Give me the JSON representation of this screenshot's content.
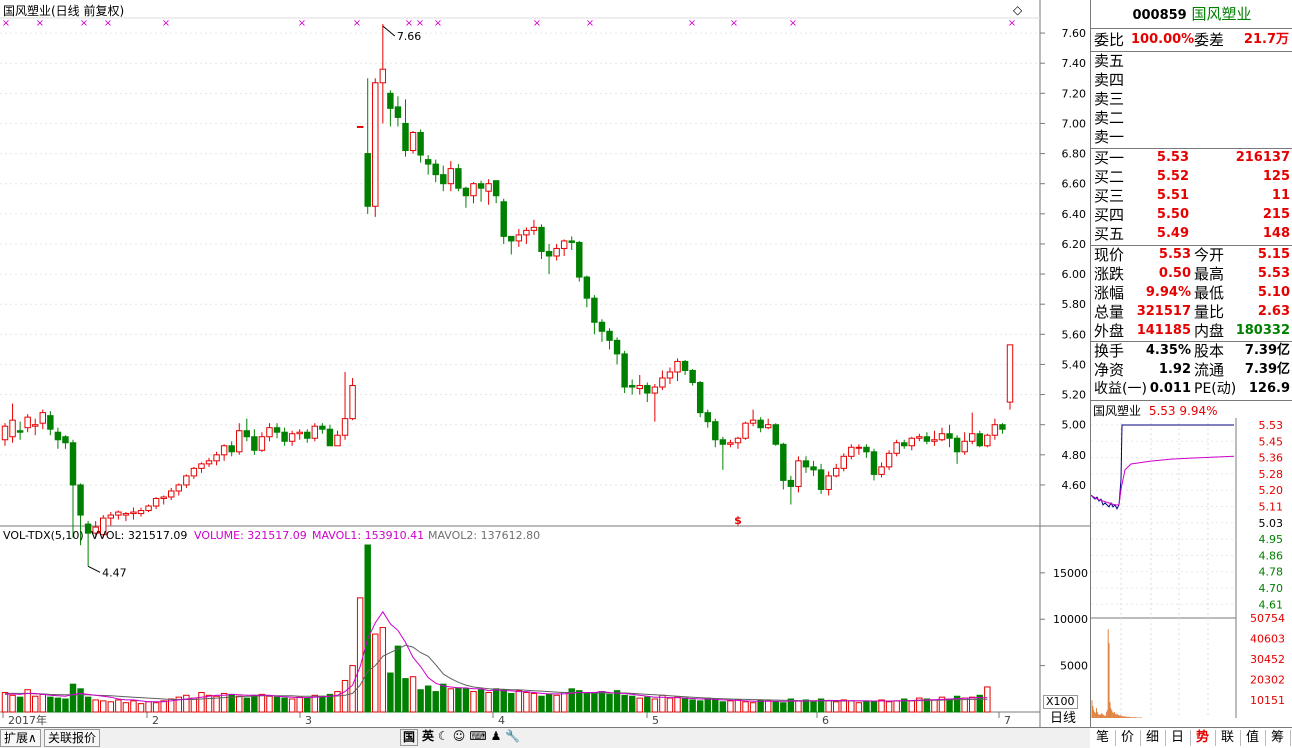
{
  "kline": {
    "header": "国风塑业(日线 前复权)",
    "high_marker": "7.66",
    "low_marker": "4.47",
    "special_marker": "$",
    "ymin": 4.5,
    "ymax": 7.7,
    "y_ticks": [
      "7.60",
      "7.40",
      "7.20",
      "7.00",
      "6.80",
      "6.60",
      "6.40",
      "6.20",
      "6.00",
      "5.80",
      "5.60",
      "5.40",
      "5.20",
      "5.00",
      "4.80",
      "4.60"
    ],
    "candles": [
      [
        4.9,
        4.99,
        4.86,
        5.01
      ],
      [
        4.92,
        5.03,
        4.88,
        5.14
      ],
      [
        4.96,
        4.95,
        4.9,
        5.02
      ],
      [
        4.98,
        5.05,
        4.95,
        5.07
      ],
      [
        4.99,
        5.0,
        4.93,
        5.04
      ],
      [
        5.01,
        5.08,
        4.97,
        5.1
      ],
      [
        5.06,
        4.97,
        4.93,
        5.09
      ],
      [
        4.95,
        4.9,
        4.84,
        4.98
      ],
      [
        4.92,
        4.88,
        4.84,
        4.93
      ],
      [
        4.88,
        4.6,
        4.25,
        4.9
      ],
      [
        4.6,
        4.4,
        4.2,
        4.61
      ],
      [
        4.34,
        4.28,
        4.06,
        4.36
      ],
      [
        4.28,
        4.32,
        4.25,
        4.36
      ],
      [
        4.27,
        4.38,
        4.25,
        4.4
      ],
      [
        4.38,
        4.4,
        4.33,
        4.42
      ],
      [
        4.4,
        4.42,
        4.37,
        4.43
      ],
      [
        4.4,
        4.41,
        4.36,
        4.42
      ],
      [
        4.41,
        4.42,
        4.37,
        4.45
      ],
      [
        4.41,
        4.43,
        4.39,
        4.45
      ],
      [
        4.43,
        4.46,
        4.42,
        4.47
      ],
      [
        4.46,
        4.51,
        4.44,
        4.52
      ],
      [
        4.51,
        4.52,
        4.47,
        4.53
      ],
      [
        4.52,
        4.56,
        4.5,
        4.58
      ],
      [
        4.56,
        4.6,
        4.53,
        4.61
      ],
      [
        4.6,
        4.66,
        4.58,
        4.67
      ],
      [
        4.66,
        4.71,
        4.64,
        4.72
      ],
      [
        4.71,
        4.74,
        4.68,
        4.75
      ],
      [
        4.74,
        4.76,
        4.72,
        4.78
      ],
      [
        4.76,
        4.8,
        4.73,
        4.82
      ],
      [
        4.8,
        4.86,
        4.76,
        4.87
      ],
      [
        4.86,
        4.82,
        4.79,
        4.89
      ],
      [
        4.82,
        4.96,
        4.8,
        5.01
      ],
      [
        4.96,
        4.92,
        4.89,
        5.04
      ],
      [
        4.92,
        4.83,
        4.8,
        4.97
      ],
      [
        4.83,
        4.92,
        4.82,
        4.95
      ],
      [
        4.92,
        4.98,
        4.89,
        5.01
      ],
      [
        4.98,
        4.95,
        4.91,
        5.01
      ],
      [
        4.95,
        4.89,
        4.86,
        4.98
      ],
      [
        4.89,
        4.94,
        4.86,
        4.96
      ],
      [
        4.94,
        4.95,
        4.9,
        4.97
      ],
      [
        4.95,
        4.91,
        4.88,
        4.97
      ],
      [
        4.91,
        4.99,
        4.89,
        5.01
      ],
      [
        4.99,
        4.97,
        4.94,
        5.01
      ],
      [
        4.97,
        4.86,
        4.86,
        5.0
      ],
      [
        4.86,
        4.93,
        4.86,
        4.96
      ],
      [
        4.93,
        5.04,
        4.9,
        5.35
      ],
      [
        5.04,
        5.26,
        5.03,
        5.31
      ],
      [
        6.98,
        6.98,
        6.98,
        6.98
      ],
      [
        6.8,
        6.45,
        6.4,
        7.3
      ],
      [
        6.45,
        7.27,
        6.38,
        7.3
      ],
      [
        7.27,
        7.36,
        7.0,
        7.66
      ],
      [
        7.2,
        7.1,
        6.98,
        7.22
      ],
      [
        7.11,
        7.04,
        6.98,
        7.18
      ],
      [
        7.0,
        6.82,
        6.78,
        7.16
      ],
      [
        6.82,
        6.94,
        6.8,
        6.95
      ],
      [
        6.94,
        6.79,
        6.74,
        6.96
      ],
      [
        6.76,
        6.73,
        6.66,
        6.79
      ],
      [
        6.73,
        6.66,
        6.61,
        6.76
      ],
      [
        6.66,
        6.6,
        6.55,
        6.72
      ],
      [
        6.6,
        6.7,
        6.55,
        6.75
      ],
      [
        6.7,
        6.57,
        6.55,
        6.73
      ],
      [
        6.57,
        6.52,
        6.44,
        6.58
      ],
      [
        6.52,
        6.6,
        6.47,
        6.61
      ],
      [
        6.6,
        6.57,
        6.48,
        6.62
      ],
      [
        6.55,
        6.6,
        6.46,
        6.63
      ],
      [
        6.62,
        6.52,
        6.47,
        6.62
      ],
      [
        6.48,
        6.25,
        6.2,
        6.5
      ],
      [
        6.25,
        6.22,
        6.13,
        6.25
      ],
      [
        6.22,
        6.26,
        6.18,
        6.3
      ],
      [
        6.26,
        6.29,
        6.2,
        6.31
      ],
      [
        6.29,
        6.31,
        6.26,
        6.36
      ],
      [
        6.31,
        6.15,
        6.1,
        6.33
      ],
      [
        6.15,
        6.12,
        6.0,
        6.2
      ],
      [
        6.12,
        6.17,
        6.09,
        6.2
      ],
      [
        6.17,
        6.22,
        6.12,
        6.23
      ],
      [
        6.22,
        6.21,
        6.16,
        6.25
      ],
      [
        6.21,
        5.98,
        5.95,
        6.22
      ],
      [
        5.98,
        5.84,
        5.78,
        5.99
      ],
      [
        5.84,
        5.68,
        5.6,
        5.86
      ],
      [
        5.68,
        5.62,
        5.55,
        5.7
      ],
      [
        5.62,
        5.56,
        5.5,
        5.64
      ],
      [
        5.56,
        5.47,
        5.4,
        5.58
      ],
      [
        5.47,
        5.25,
        5.21,
        5.49
      ],
      [
        5.26,
        5.25,
        5.2,
        5.3
      ],
      [
        5.24,
        5.26,
        5.2,
        5.33
      ],
      [
        5.26,
        5.21,
        5.15,
        5.28
      ],
      [
        5.21,
        5.25,
        5.02,
        5.27
      ],
      [
        5.25,
        5.31,
        5.23,
        5.36
      ],
      [
        5.31,
        5.35,
        5.27,
        5.38
      ],
      [
        5.35,
        5.42,
        5.29,
        5.44
      ],
      [
        5.42,
        5.36,
        5.33,
        5.43
      ],
      [
        5.36,
        5.28,
        5.26,
        5.37
      ],
      [
        5.28,
        5.08,
        5.05,
        5.29
      ],
      [
        5.08,
        5.02,
        4.98,
        5.1
      ],
      [
        5.02,
        4.9,
        4.85,
        5.04
      ],
      [
        4.9,
        4.87,
        4.7,
        4.92
      ],
      [
        4.87,
        4.88,
        4.85,
        4.9
      ],
      [
        4.88,
        4.91,
        4.84,
        4.92
      ],
      [
        4.91,
        5.01,
        4.9,
        5.02
      ],
      [
        5.01,
        5.03,
        4.99,
        5.1
      ],
      [
        5.03,
        4.98,
        4.95,
        5.05
      ],
      [
        4.98,
        5.0,
        4.97,
        5.04
      ],
      [
        5.0,
        4.87,
        4.86,
        5.01
      ],
      [
        4.87,
        4.63,
        4.57,
        4.88
      ],
      [
        4.63,
        4.59,
        4.47,
        4.66
      ],
      [
        4.59,
        4.76,
        4.55,
        4.79
      ],
      [
        4.76,
        4.72,
        4.68,
        4.79
      ],
      [
        4.72,
        4.7,
        4.66,
        4.76
      ],
      [
        4.7,
        4.57,
        4.54,
        4.74
      ],
      [
        4.57,
        4.66,
        4.53,
        4.69
      ],
      [
        4.66,
        4.71,
        4.65,
        4.74
      ],
      [
        4.71,
        4.79,
        4.69,
        4.81
      ],
      [
        4.79,
        4.85,
        4.77,
        4.87
      ],
      [
        4.85,
        4.85,
        4.8,
        4.87
      ],
      [
        4.85,
        4.82,
        4.78,
        4.87
      ],
      [
        4.82,
        4.67,
        4.63,
        4.84
      ],
      [
        4.67,
        4.72,
        4.65,
        4.75
      ],
      [
        4.72,
        4.81,
        4.7,
        4.83
      ],
      [
        4.81,
        4.88,
        4.79,
        4.9
      ],
      [
        4.88,
        4.86,
        4.84,
        4.9
      ],
      [
        4.86,
        4.91,
        4.83,
        4.92
      ],
      [
        4.91,
        4.92,
        4.89,
        4.94
      ],
      [
        4.92,
        4.89,
        4.87,
        4.95
      ],
      [
        4.89,
        4.9,
        4.86,
        4.96
      ],
      [
        4.9,
        4.94,
        4.89,
        4.98
      ],
      [
        4.94,
        4.91,
        4.85,
        5.0
      ],
      [
        4.91,
        4.82,
        4.74,
        4.93
      ],
      [
        4.82,
        4.89,
        4.8,
        4.95
      ],
      [
        4.89,
        4.94,
        4.87,
        5.08
      ],
      [
        4.94,
        4.86,
        4.85,
        4.96
      ],
      [
        4.86,
        4.93,
        4.85,
        4.94
      ],
      [
        4.93,
        5.0,
        4.9,
        5.04
      ],
      [
        5.0,
        4.97,
        4.94,
        5.01
      ],
      [
        5.15,
        5.53,
        5.1,
        5.53
      ]
    ]
  },
  "vol": {
    "header": {
      "name": "VOL-TDX(5,10)",
      "vvol": "VVOL: 321517.09",
      "volume": "VOLUME: 321517.09",
      "mavol1": "MAVOL1: 153910.41",
      "mavol2": "MAVOL2: 137612.80"
    },
    "ymax": 18000,
    "y_ticks": [
      "15000",
      "10000",
      "5000"
    ],
    "unit": "X100",
    "values": [
      2100,
      1800,
      1600,
      2400,
      1700,
      1900,
      1600,
      1500,
      1400,
      3000,
      2500,
      1600,
      1300,
      1200,
      1100,
      1300,
      1000,
      1200,
      900,
      1100,
      1000,
      1200,
      1400,
      1600,
      1800,
      1500,
      2100,
      1800,
      1700,
      2000,
      1900,
      1700,
      1500,
      1800,
      1900,
      1700,
      1600,
      1500,
      1400,
      1600,
      1500,
      1800,
      1700,
      1900,
      2200,
      3400,
      5000,
      12300,
      18000,
      8400,
      9100,
      4200,
      7100,
      3600,
      3800,
      2400,
      2800,
      2200,
      3000,
      2500,
      2600,
      2500,
      2200,
      2400,
      2100,
      2500,
      2400,
      2000,
      2300,
      2100,
      2000,
      1700,
      1900,
      1800,
      2100,
      2500,
      2300,
      2000,
      2100,
      2200,
      1900,
      2300,
      1800,
      1700,
      1500,
      1600,
      1400,
      1800,
      1500,
      1600,
      1500,
      1300,
      1200,
      1500,
      1400,
      1100,
      1200,
      1300,
      1100,
      1000,
      1300,
      1200,
      1100,
      1000,
      1400,
      1200,
      1300,
      1100,
      1400,
      1200,
      1100,
      1300,
      1200,
      1000,
      1200,
      1100,
      1300,
      1100,
      1200,
      1400,
      1200,
      1500,
      1400,
      1300,
      1600,
      1400,
      1700,
      1500,
      1600,
      1800,
      2700
    ],
    "mavol1": [
      1900,
      1950,
      1900,
      2000,
      2000,
      1900,
      1800,
      1750,
      1700,
      1900,
      2000,
      1900,
      1800,
      1700,
      1600,
      1400,
      1300,
      1300,
      1200,
      1100,
      1100,
      1100,
      1200,
      1300,
      1400,
      1500,
      1600,
      1700,
      1800,
      1800,
      1900,
      1850,
      1800,
      1800,
      1800,
      1800,
      1700,
      1650,
      1600,
      1550,
      1550,
      1600,
      1650,
      1700,
      1800,
      2200,
      2900,
      4900,
      7900,
      9600,
      10800,
      9500,
      8800,
      7500,
      5900,
      4900,
      3700,
      3100,
      2800,
      2700,
      2600,
      2600,
      2500,
      2500,
      2300,
      2400,
      2300,
      2300,
      2200,
      2200,
      2100,
      2000,
      1950,
      1950,
      1950,
      2000,
      2100,
      2100,
      2100,
      2200,
      2100,
      2000,
      2000,
      1900,
      1800,
      1700,
      1600,
      1600,
      1550,
      1550,
      1500,
      1450,
      1400,
      1400,
      1350,
      1300,
      1280,
      1250,
      1200,
      1150,
      1150,
      1150,
      1150,
      1150,
      1180,
      1180,
      1190,
      1200,
      1220,
      1250,
      1240,
      1230,
      1220,
      1210,
      1200,
      1190,
      1200,
      1180,
      1200,
      1220,
      1240,
      1280,
      1300,
      1330,
      1360,
      1400,
      1440,
      1480,
      1520,
      1560,
      1540
    ],
    "mavol2": [
      2000,
      2000,
      2000,
      2000,
      1950,
      1950,
      1900,
      1880,
      1850,
      1850,
      1850,
      1850,
      1800,
      1780,
      1750,
      1700,
      1650,
      1600,
      1550,
      1500,
      1450,
      1400,
      1350,
      1350,
      1350,
      1350,
      1400,
      1450,
      1500,
      1550,
      1600,
      1650,
      1700,
      1700,
      1750,
      1750,
      1750,
      1750,
      1750,
      1700,
      1700,
      1700,
      1700,
      1700,
      1720,
      1800,
      2000,
      2900,
      4400,
      5000,
      6000,
      6400,
      6800,
      7200,
      7000,
      6400,
      6000,
      5100,
      4100,
      3600,
      3200,
      2900,
      2700,
      2600,
      2500,
      2450,
      2450,
      2400,
      2400,
      2350,
      2300,
      2250,
      2200,
      2150,
      2100,
      2100,
      2100,
      2050,
      2050,
      2050,
      2050,
      2050,
      2050,
      2000,
      1950,
      1900,
      1850,
      1800,
      1750,
      1700,
      1650,
      1600,
      1550,
      1500,
      1450,
      1420,
      1400,
      1380,
      1360,
      1340,
      1320,
      1300,
      1280,
      1260,
      1240,
      1230,
      1220,
      1210,
      1200,
      1190,
      1190,
      1190,
      1190,
      1190,
      1190,
      1190,
      1190,
      1190,
      1200,
      1210,
      1220,
      1230,
      1240,
      1260,
      1280,
      1300,
      1320,
      1340,
      1360,
      1380,
      1376
    ]
  },
  "xaxis": {
    "labels": [
      [
        "2017年",
        6
      ],
      [
        "2",
        150
      ],
      [
        "3",
        303
      ],
      [
        "4",
        496
      ],
      [
        "5",
        650
      ],
      [
        "6",
        820
      ],
      [
        "7",
        1002
      ]
    ],
    "right_label": "日线"
  },
  "markers_top": [
    6,
    40,
    84,
    108,
    166,
    302,
    357,
    409,
    420,
    438,
    537,
    590,
    692,
    734,
    793,
    1012
  ],
  "bottom": {
    "expand": "扩展∧",
    "related": "关联报价",
    "toolbar": [
      "国",
      "英",
      "☾",
      "☺",
      "⌨",
      "♟",
      "🔧"
    ]
  },
  "panel": {
    "code": "000859",
    "name": "国风塑业",
    "weibi_label": "委比",
    "weibi": "100.00%",
    "weicha_label": "委差",
    "weicha": "21.7万",
    "sells": [
      {
        "label": "卖五",
        "price": "",
        "vol": ""
      },
      {
        "label": "卖四",
        "price": "",
        "vol": ""
      },
      {
        "label": "卖三",
        "price": "",
        "vol": ""
      },
      {
        "label": "卖二",
        "price": "",
        "vol": ""
      },
      {
        "label": "卖一",
        "price": "",
        "vol": ""
      }
    ],
    "buys": [
      {
        "label": "买一",
        "price": "5.53",
        "vol": "216137"
      },
      {
        "label": "买二",
        "price": "5.52",
        "vol": "125"
      },
      {
        "label": "买三",
        "price": "5.51",
        "vol": "11"
      },
      {
        "label": "买四",
        "price": "5.50",
        "vol": "215"
      },
      {
        "label": "买五",
        "price": "5.49",
        "vol": "148"
      }
    ],
    "stats": [
      [
        [
          "现价",
          "5.53",
          "red"
        ],
        [
          "今开",
          "5.15",
          "red"
        ]
      ],
      [
        [
          "涨跌",
          "0.50",
          "red"
        ],
        [
          "最高",
          "5.53",
          "red"
        ]
      ],
      [
        [
          "涨幅",
          "9.94%",
          "red"
        ],
        [
          "最低",
          "5.10",
          "red"
        ]
      ],
      [
        [
          "总量",
          "321517",
          "red"
        ],
        [
          "量比",
          "2.63",
          "red"
        ]
      ],
      [
        [
          "外盘",
          "141185",
          "red"
        ],
        [
          "内盘",
          "180332",
          "grn"
        ]
      ]
    ],
    "stats2": [
      [
        [
          "换手",
          "4.35%"
        ],
        [
          "股本",
          "7.39亿"
        ]
      ],
      [
        [
          "净资",
          "1.92"
        ],
        [
          "流通",
          "7.39亿"
        ]
      ],
      [
        [
          "收益(一)",
          "0.011"
        ],
        [
          "PE(动)",
          "126.9"
        ]
      ]
    ],
    "mini_title": "国风塑业",
    "mini_price": "5.53",
    "mini_pct": "9.94%",
    "mini_price_ticks": [
      "5.53",
      "5.45",
      "5.36",
      "5.28",
      "5.20",
      "5.11",
      "5.03",
      "4.95",
      "4.86",
      "4.78",
      "4.70",
      "4.61"
    ],
    "mini_vol_ticks": [
      "50754",
      "40603",
      "30452",
      "20302",
      "10151"
    ],
    "tabs": [
      "笔",
      "价",
      "细",
      "日",
      "势",
      "联",
      "值",
      "筹"
    ],
    "active_tab": "势"
  },
  "colors": {
    "up": "#e60000",
    "down": "#008000",
    "ma1": "#cc00cc",
    "ma2": "#606060",
    "line": "#000080"
  }
}
